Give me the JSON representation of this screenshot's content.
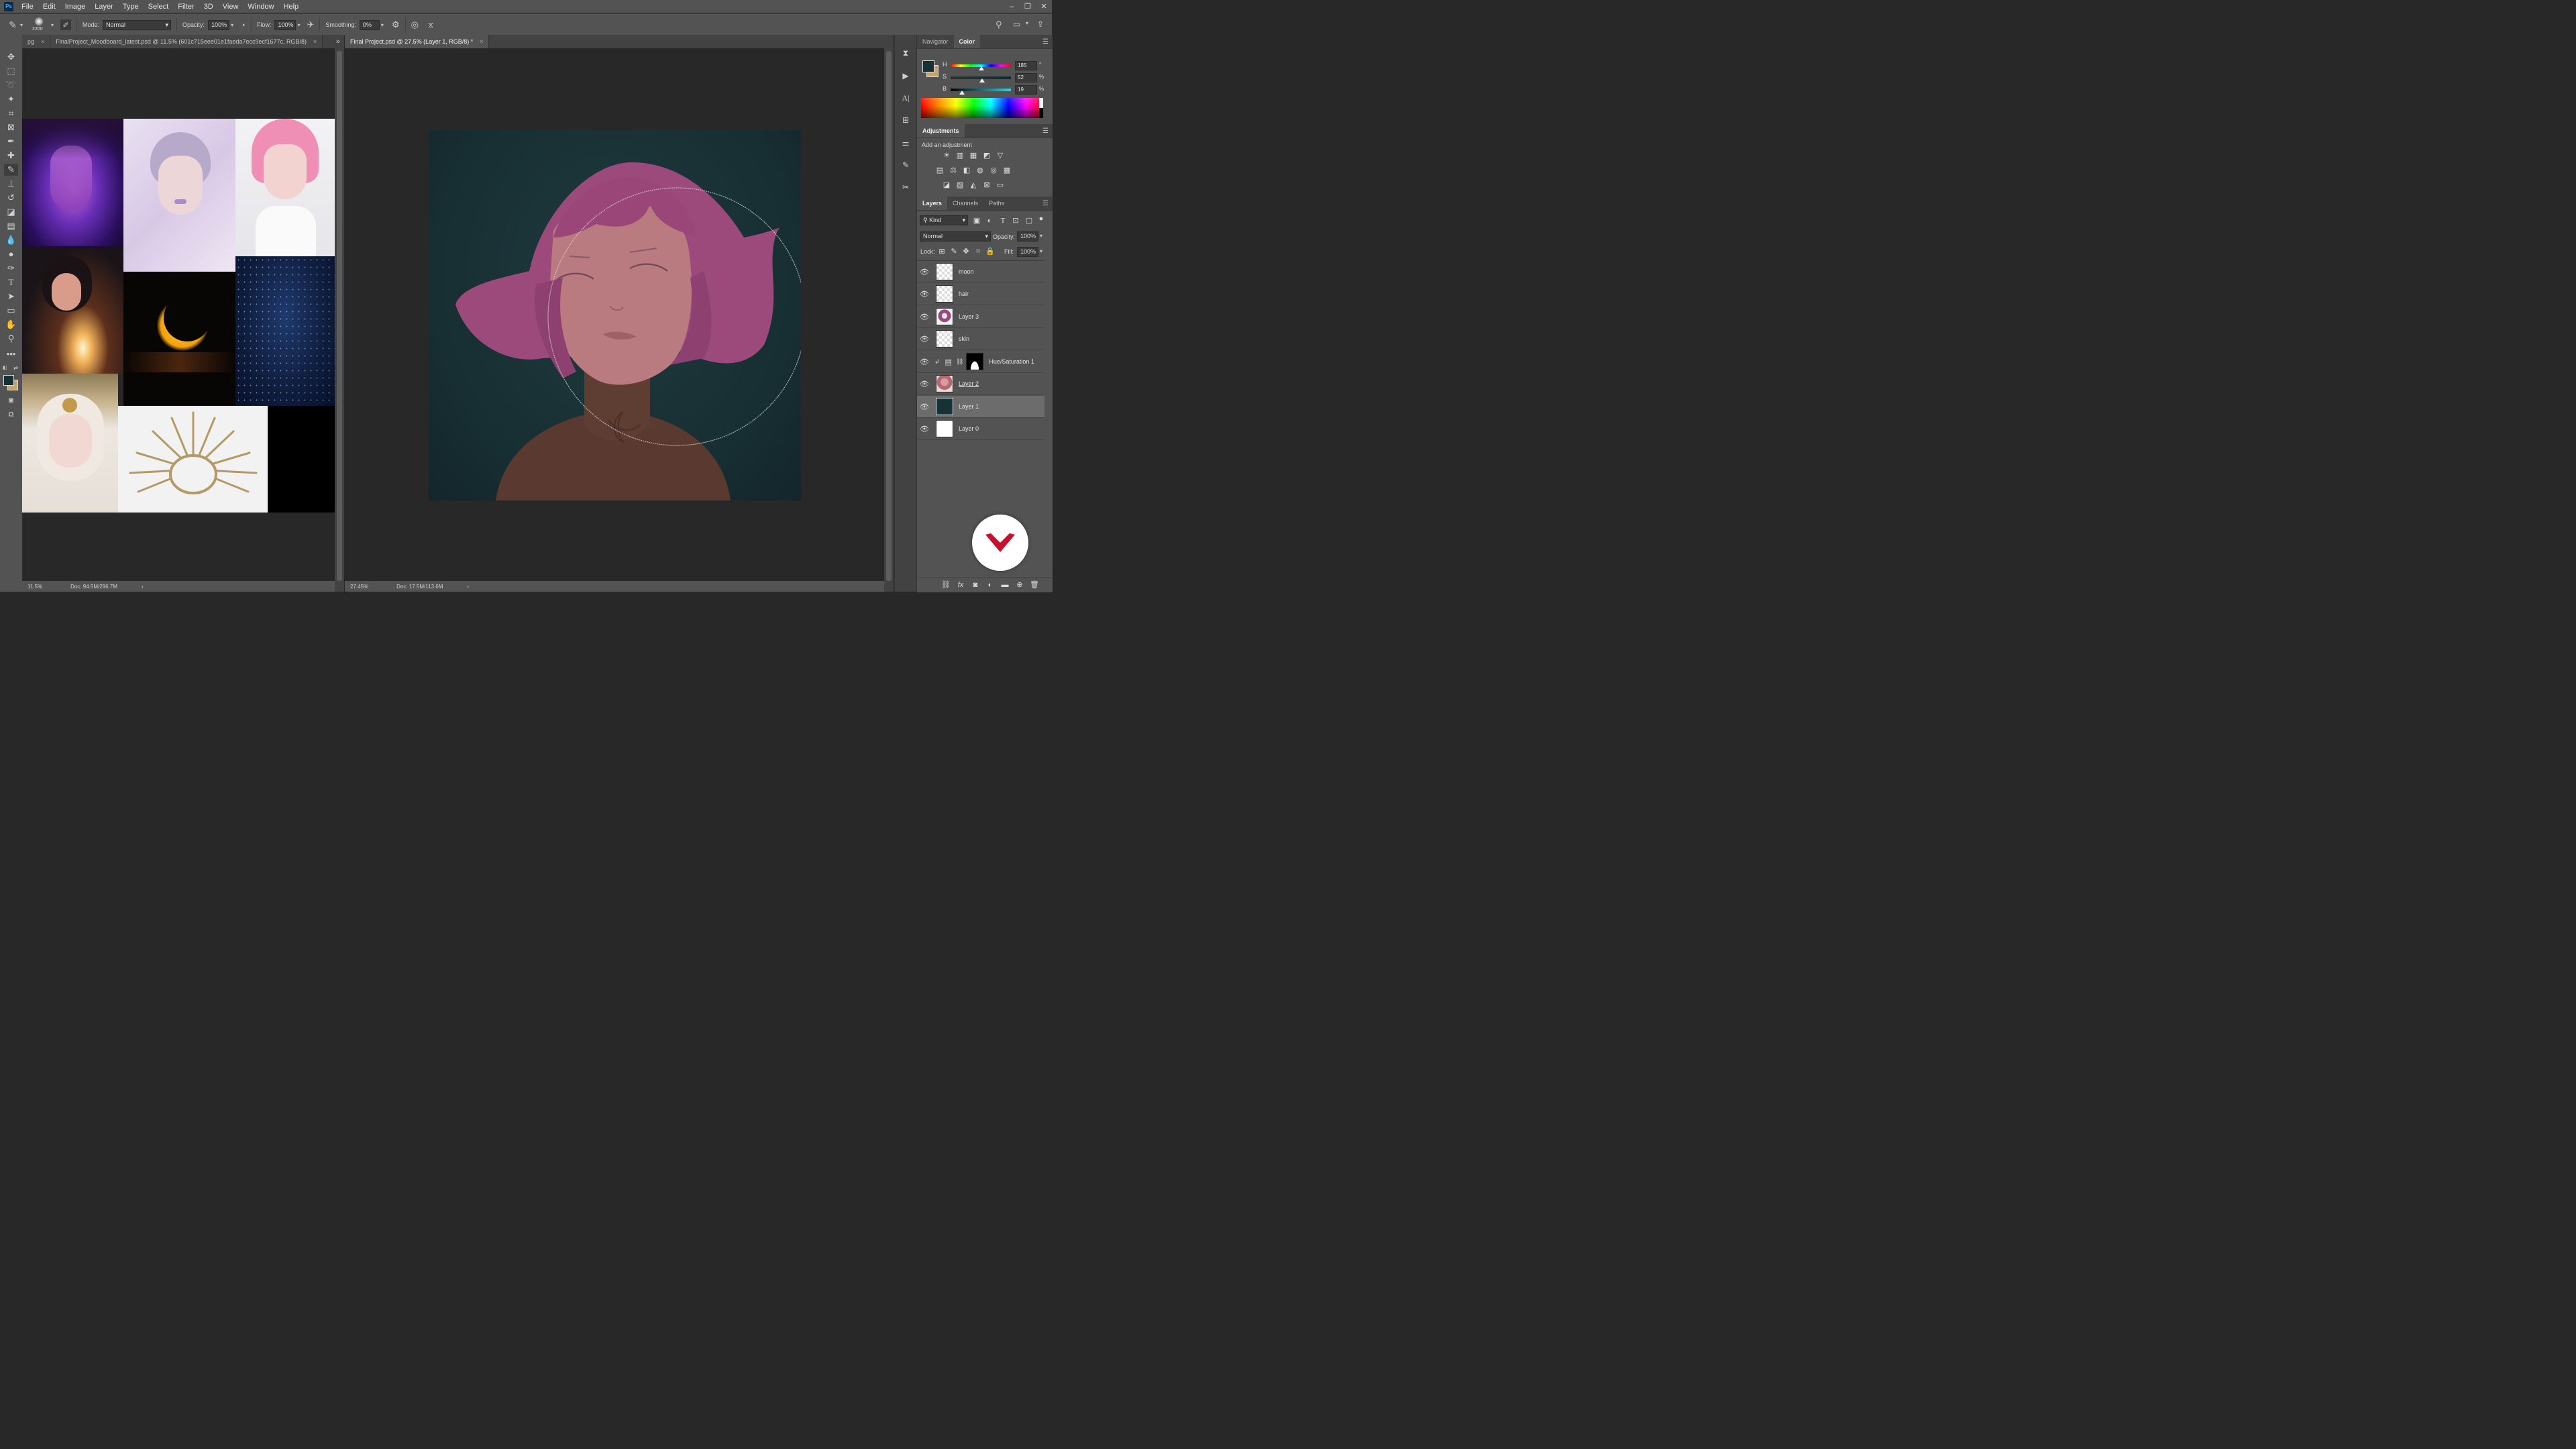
{
  "app": {
    "logo_text": "Ps"
  },
  "menu": [
    "File",
    "Edit",
    "Image",
    "Layer",
    "Type",
    "Select",
    "Filter",
    "3D",
    "View",
    "Window",
    "Help"
  ],
  "window_controls": {
    "minimize": "–",
    "restore": "❐",
    "close": "✕"
  },
  "options_bar": {
    "brush_size": "2200",
    "mode_label": "Mode:",
    "mode_value": "Normal",
    "opacity_label": "Opacity:",
    "opacity_value": "100%",
    "flow_label": "Flow:",
    "flow_value": "100%",
    "smoothing_label": "Smoothing:",
    "smoothing_value": "0%"
  },
  "tabs": {
    "left_partial": "pg",
    "left_doc": "FinalProject_Moodboard_latest.psd @ 11.5% (601c715eee01e1faeda7ecc9ecf1677c, RGB/8)",
    "right_doc": "Final Project.psd @ 27.5% (Layer 1, RGB/8) *",
    "close_glyph": "×",
    "overflow_glyph": "»"
  },
  "status": {
    "left_zoom": "11.5%",
    "left_doc": "Doc: 94.5M/296.7M",
    "right_zoom": "27.45%",
    "right_doc": "Doc: 17.5M/113.6M",
    "arrow": "›"
  },
  "color_panel": {
    "tabs": [
      "Navigator",
      "Color"
    ],
    "active_tab": "Color",
    "h_label": "H",
    "h_value": "185",
    "h_unit": "°",
    "s_label": "S",
    "s_value": "52",
    "s_unit": "%",
    "b_label": "B",
    "b_value": "19",
    "b_unit": "%",
    "h_fraction": 0.514,
    "s_fraction": 0.52,
    "b_fraction": 0.19,
    "foreground_color": "#173236",
    "background_color": "#c9a46a"
  },
  "adjustments_panel": {
    "title": "Adjustments",
    "subtitle": "Add an adjustment"
  },
  "layers_panel": {
    "tabs": [
      "Layers",
      "Channels",
      "Paths"
    ],
    "active_tab": "Layers",
    "filter_kind": "Kind",
    "blend_mode": "Normal",
    "opacity_label": "Opacity:",
    "opacity_value": "100%",
    "lock_label": "Lock:",
    "fill_label": "Fill:",
    "fill_value": "100%",
    "layers": [
      {
        "name": "moon",
        "thumb": "transparent",
        "selected": false
      },
      {
        "name": "hair",
        "thumb": "transparent",
        "selected": false
      },
      {
        "name": "Layer 3",
        "thumb": "portrait-purple",
        "selected": false
      },
      {
        "name": "skin",
        "thumb": "transparent",
        "selected": false
      },
      {
        "name": "Hue/Saturation 1",
        "thumb": "adjustment",
        "selected": false
      },
      {
        "name": "Layer 2",
        "thumb": "portrait-pink",
        "selected": false
      },
      {
        "name": "Layer 1",
        "thumb": "dark-teal",
        "selected": true
      },
      {
        "name": "Layer 0",
        "thumb": "white",
        "selected": false
      }
    ]
  },
  "colors": {
    "canvas_bg": "#1d3034",
    "hair": "#9c4a7c",
    "skin": "#b97a80",
    "shirt": "#5a3a30",
    "brand_red": "#c8102e"
  }
}
